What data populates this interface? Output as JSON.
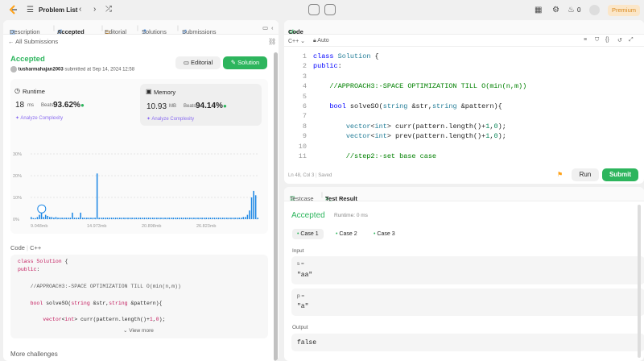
{
  "nav": {
    "title": "Problem List",
    "premium": "Premium",
    "streak": "0",
    "icons": [
      "logo-icon",
      "list-icon",
      "prev-icon",
      "next-icon",
      "shuffle-icon",
      "timer-icon",
      "note-icon",
      "grid-icon",
      "gear-icon",
      "fire-icon",
      "avatar"
    ]
  },
  "left_tabs": {
    "description": "Description",
    "accepted": "Accepted",
    "editorial": "Editorial",
    "solutions": "Solutions",
    "submissions": "Submissions"
  },
  "back": "All Submissions",
  "status": "Accepted",
  "user": "tusharmahajan2003",
  "submitted": "submitted at Sep 14, 2024 12:58",
  "editorial_btn": "Editorial",
  "solution_btn": "Solution",
  "runtime": {
    "label": "Runtime",
    "value": "18",
    "unit": "ms",
    "beats_label": "Beats",
    "beats": "93.62%",
    "analyze": "Analyze Complexity"
  },
  "memory": {
    "label": "Memory",
    "value": "10.93",
    "unit": "MB",
    "beats_label": "Beats",
    "beats": "94.14%",
    "analyze": "Analyze Complexity"
  },
  "chart_data": {
    "type": "bar",
    "yticks": [
      "30%",
      "20%",
      "10%",
      "0%"
    ],
    "xticks": [
      "9.048mb",
      "14.973mb",
      "20.898mb",
      "26.823mb"
    ],
    "ylim": [
      0,
      30
    ],
    "values": [
      1,
      0.5,
      0.5,
      1,
      2,
      4,
      1,
      2,
      1.5,
      1,
      1,
      0.7,
      1,
      0.7,
      0.7,
      0.7,
      0.7,
      0.7,
      0.7,
      0.7,
      3,
      0.7,
      0.7,
      0.7,
      3,
      0.7,
      0.7,
      0.7,
      0.7,
      0.7,
      0.7,
      0.7,
      21,
      0.7,
      0.7,
      0.7,
      0.7,
      0.7,
      0.7,
      0.7,
      0.7,
      0.7,
      0.7,
      0.7,
      0.7,
      0.7,
      0.7,
      0.7,
      0.7,
      0.7,
      0.7,
      0.7,
      0.7,
      0.7,
      0.7,
      0.7,
      0.7,
      0.7,
      0.7,
      0.7,
      0.7,
      0.7,
      0.7,
      0.7,
      0.7,
      0.7,
      0.7,
      0.7,
      0.7,
      0.7,
      0.7,
      0.7,
      0.7,
      0.7,
      0.7,
      0.7,
      0.7,
      0.7,
      0.7,
      0.7,
      0.7,
      0.7,
      0.7,
      0.7,
      0.7,
      0.7,
      0.7,
      0.7,
      0.7,
      0.7,
      0.7,
      0.7,
      0.7,
      0.7,
      0.7,
      0.7,
      0.7,
      0.7,
      0.7,
      0.7,
      0.7,
      0.7,
      0.7,
      1,
      1,
      2,
      4,
      10,
      13,
      11,
      0.7
    ],
    "highlight_index": 5
  },
  "code_lang_label": "Code",
  "code_lang": "C++",
  "preview_lines": [
    "class Solution {",
    "public:",
    "",
    "    //APPROACH3:-SPACE OPTIMIZATION TILL O(min(n,m))",
    "",
    "    bool solveSO(string &str,string &pattern){",
    "",
    "        vector<int> curr(pattern.length()+1,0);"
  ],
  "view_more": "View more",
  "more_challenges": "More challenges",
  "editor": {
    "title": "Code",
    "lang": "C++",
    "auto": "Auto",
    "status": "Ln 48, Col 3",
    "saved": "Saved",
    "run": "Run",
    "submit": "Submit",
    "lines": [
      "class Solution {",
      "public:",
      "",
      "    //APPROACH3:-SPACE OPTIMIZATION TILL O(min(n,m))",
      "",
      "    bool solveSO(string &str,string &pattern){",
      "",
      "        vector<int> curr(pattern.length()+1,0);",
      "        vector<int> prev(pattern.length()+1,0);",
      "",
      "        //step2:-set base case"
    ]
  },
  "result": {
    "testcase": "Testcase",
    "tab": "Test Result",
    "status": "Accepted",
    "runtime": "Runtime: 0 ms",
    "cases": [
      "Case 1",
      "Case 2",
      "Case 3"
    ],
    "input_label": "Input",
    "s_label": "s =",
    "s_value": "\"aa\"",
    "p_label": "p =",
    "p_value": "\"a\"",
    "output_label": "Output",
    "output_value": "false"
  }
}
